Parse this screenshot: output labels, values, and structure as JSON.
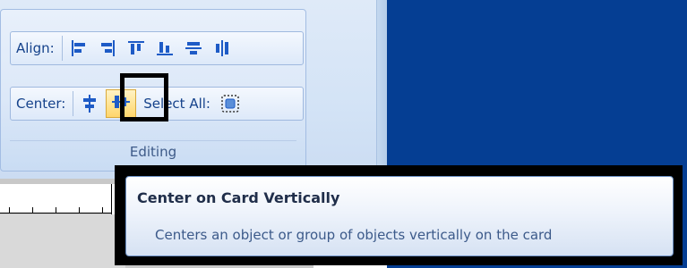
{
  "ribbon": {
    "align_label": "Align:",
    "center_label": "Center:",
    "select_all_label": "Select All:",
    "group_caption": "Editing",
    "align_icons": [
      "align-left-icon",
      "align-right-icon",
      "align-top-icon",
      "align-bottom-icon",
      "align-middle-icon",
      "align-center-icon"
    ],
    "center_icons": [
      "center-horizontally-icon",
      "center-vertically-icon"
    ],
    "select_all_icon": "select-all-icon"
  },
  "tooltip": {
    "title": "Center on Card Vertically",
    "description": "Centers an object or group of objects vertically on the card"
  },
  "colors": {
    "accent_blue": "#1e5bc6",
    "label_text": "#15428b",
    "highlight": "#ffd66b",
    "panel_blue": "#053e93"
  }
}
